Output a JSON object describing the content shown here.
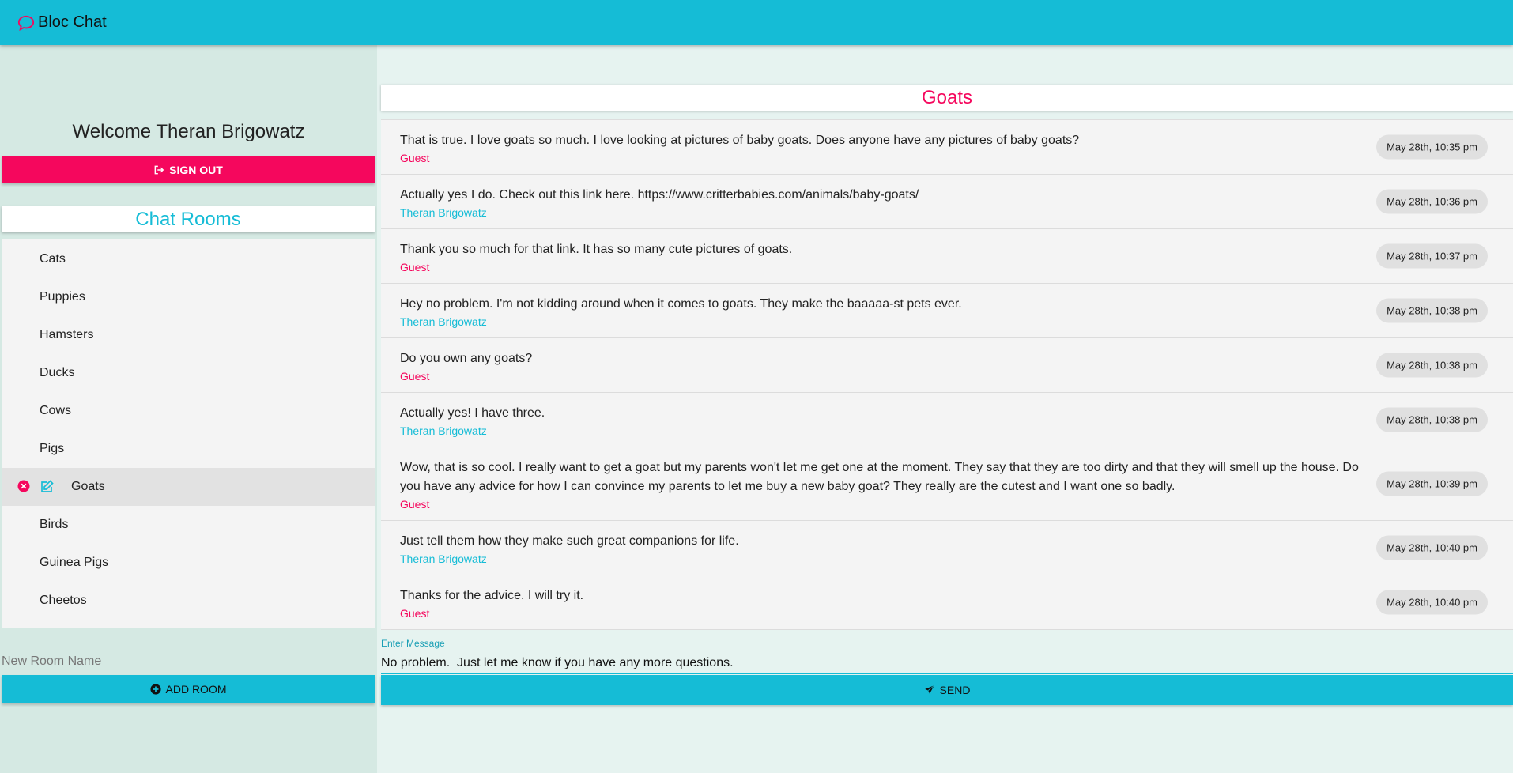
{
  "header": {
    "app_title": "Bloc Chat",
    "icon": "chat-bubble-icon"
  },
  "sidebar": {
    "welcome": "Welcome Theran Brigowatz",
    "sign_out_label": "SIGN OUT",
    "rooms_title": "Chat Rooms",
    "rooms": [
      {
        "label": "Cats"
      },
      {
        "label": "Puppies"
      },
      {
        "label": "Hamsters"
      },
      {
        "label": "Ducks"
      },
      {
        "label": "Cows"
      },
      {
        "label": "Pigs"
      },
      {
        "label": "Goats",
        "active": true
      },
      {
        "label": "Birds"
      },
      {
        "label": "Guinea Pigs"
      },
      {
        "label": "Cheetos"
      }
    ],
    "new_room_placeholder": "New Room Name",
    "add_room_label": "ADD ROOM"
  },
  "main": {
    "room_title": "Goats",
    "messages": [
      {
        "text": "That is true. I love goats so much. I love looking at pictures of baby goats. Does anyone have any pictures of baby goats?",
        "author": "Guest",
        "time": "May 28th, 10:35 pm"
      },
      {
        "text": "Actually yes I do. Check out this link here. https://www.critterbabies.com/animals/baby-goats/",
        "author": "Theran Brigowatz",
        "time": "May 28th, 10:36 pm"
      },
      {
        "text": "Thank you so much for that link. It has so many cute pictures of goats.",
        "author": "Guest",
        "time": "May 28th, 10:37 pm"
      },
      {
        "text": "Hey no problem. I'm not kidding around when it comes to goats. They make the baaaaa-st pets ever.",
        "author": "Theran Brigowatz",
        "time": "May 28th, 10:38 pm"
      },
      {
        "text": "Do you own any goats?",
        "author": "Guest",
        "time": "May 28th, 10:38 pm"
      },
      {
        "text": "Actually yes! I have three.",
        "author": "Theran Brigowatz",
        "time": "May 28th, 10:38 pm"
      },
      {
        "text": "Wow, that is so cool. I really want to get a goat but my parents won't let me get one at the moment. They say that they are too dirty and that they will smell up the house. Do you have any advice for how I can convince my parents to let me buy a new baby goat? They really are the cutest and I want one so badly.",
        "author": "Guest",
        "time": "May 28th, 10:39 pm"
      },
      {
        "text": "Just tell them how they make such great companions for life.",
        "author": "Theran Brigowatz",
        "time": "May 28th, 10:40 pm"
      },
      {
        "text": "Thanks for the advice. I will try it.",
        "author": "Guest",
        "time": "May 28th, 10:40 pm"
      }
    ],
    "enter_message_label": "Enter Message",
    "message_input_value": "No problem.  Just let me know if you have any more questions.",
    "send_label": "SEND"
  },
  "colors": {
    "accent_cyan": "#15bcd6",
    "accent_pink": "#f5075d",
    "sidebar_bg": "#d5e9e3",
    "page_bg": "#e6f3f0"
  }
}
